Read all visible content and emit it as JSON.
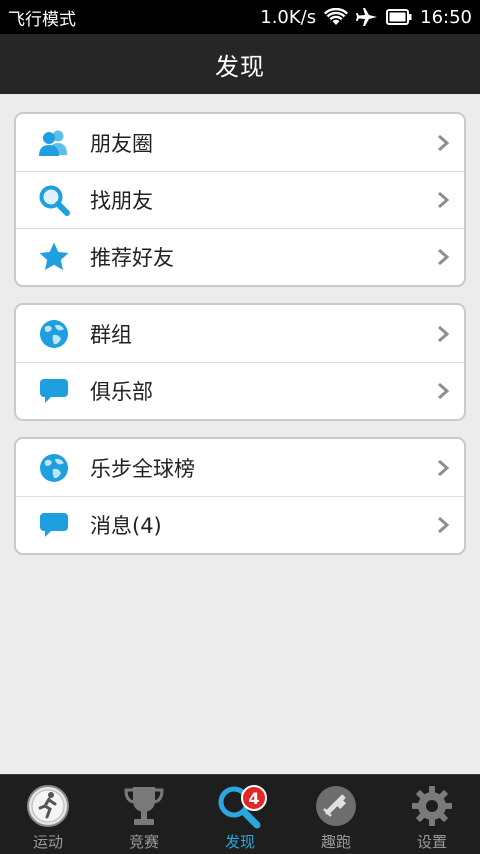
{
  "status_bar": {
    "mode": "飞行模式",
    "speed": "1.0K/s",
    "time": "16:50"
  },
  "header": {
    "title": "发现"
  },
  "groups": [
    {
      "items": [
        {
          "label": "朋友圈",
          "icon": "friends-icon"
        },
        {
          "label": "找朋友",
          "icon": "search-icon"
        },
        {
          "label": "推荐好友",
          "icon": "star-icon"
        }
      ]
    },
    {
      "items": [
        {
          "label": "群组",
          "icon": "globe-icon"
        },
        {
          "label": "俱乐部",
          "icon": "chat-bubble-icon"
        }
      ]
    },
    {
      "items": [
        {
          "label": "乐步全球榜",
          "icon": "globe-icon"
        },
        {
          "label": "消息(4)",
          "icon": "chat-bubble-icon"
        }
      ]
    }
  ],
  "tabs": [
    {
      "label": "运动",
      "icon": "runner-icon",
      "active": false
    },
    {
      "label": "竞赛",
      "icon": "trophy-icon",
      "active": false
    },
    {
      "label": "发现",
      "icon": "discover-search-icon",
      "active": true,
      "badge": "4"
    },
    {
      "label": "趣跑",
      "icon": "satellite-icon",
      "active": false
    },
    {
      "label": "设置",
      "icon": "gear-icon",
      "active": false
    }
  ],
  "colors": {
    "accent": "#2aa7df",
    "badge": "#e42626",
    "icon_blue": "#1e9fe0"
  }
}
